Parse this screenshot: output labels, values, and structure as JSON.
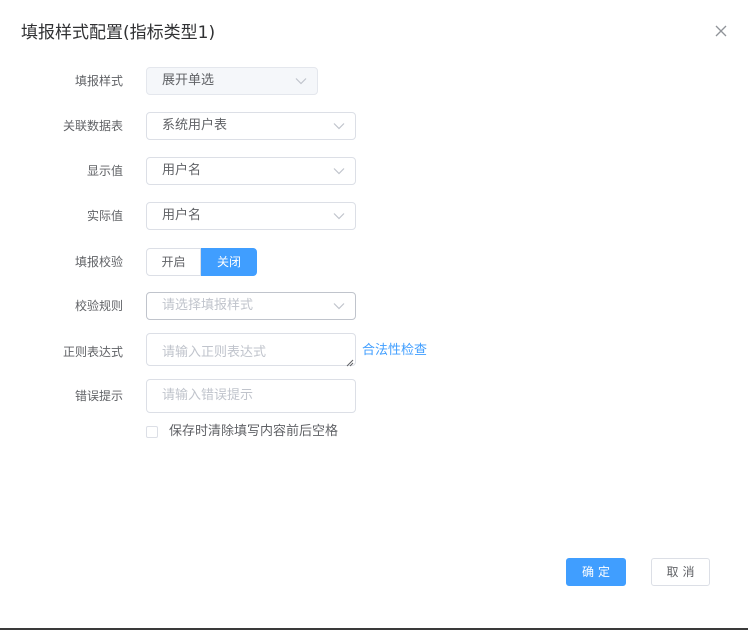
{
  "dialog": {
    "title": "填报样式配置(指标类型1)",
    "close_icon": "close-icon"
  },
  "form": {
    "fill_style": {
      "label": "填报样式",
      "value": "展开单选",
      "disabled": true
    },
    "linked_table": {
      "label": "关联数据表",
      "value": "系统用户表"
    },
    "display_value": {
      "label": "显示值",
      "value": "用户名"
    },
    "actual_value": {
      "label": "实际值",
      "value": "用户名"
    },
    "validation": {
      "label": "填报校验",
      "options": [
        "开启",
        "关闭"
      ],
      "selected": "关闭"
    },
    "validation_rule": {
      "label": "校验规则",
      "placeholder": "请选择填报样式"
    },
    "regex": {
      "label": "正则表达式",
      "placeholder": "请输入正则表达式",
      "check_link": "合法性检查"
    },
    "error_hint": {
      "label": "错误提示",
      "placeholder": "请输入错误提示"
    },
    "trim_option": {
      "label": "保存时清除填写内容前后空格",
      "checked": false
    }
  },
  "footer": {
    "confirm_label": "确定",
    "cancel_label": "取消"
  },
  "colors": {
    "accent": "#409eff",
    "border": "#dcdfe6",
    "placeholder": "#c0c4cc",
    "label": "#606266"
  }
}
